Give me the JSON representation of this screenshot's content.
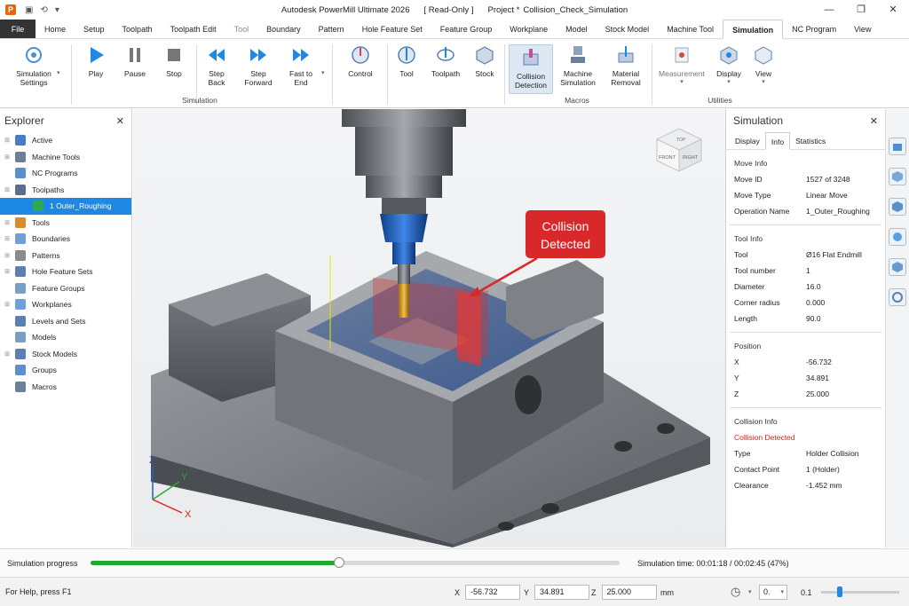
{
  "titlebar": {
    "logo": "P",
    "app_title": "Autodesk PowerMill Ultimate 2026",
    "readonly": "[ Read-Only ]",
    "project": "Project *",
    "file": "Collision_Check_Simulation"
  },
  "menu": {
    "file": "File",
    "tabs": [
      "Home",
      "Setup",
      "Toolpath",
      "Toolpath Edit",
      "Tool",
      "Boundary",
      "Pattern",
      "Hole Feature Set",
      "Feature Group",
      "Workplane",
      "Model",
      "Stock Model",
      "Machine Tool",
      "Simulation",
      "NC Program",
      "View"
    ]
  },
  "ribbon": {
    "simulation_settings": "Simulation Settings",
    "play": "Play",
    "pause": "Pause",
    "stop": "Stop",
    "step_back": "Step Back",
    "step_forward": "Step Forward",
    "fast_to_end": "Fast to End",
    "control": "Control",
    "tool": "Tool",
    "toolpath": "Toolpath",
    "stock": "Stock",
    "collision_detection": "Collision Detection",
    "machine_simulation": "Machine Simulation",
    "material_removal": "Material Removal",
    "measurement": "Measurement",
    "display": "Display",
    "view": "View",
    "group_simulation": "Simulation",
    "group_macros": "Macros",
    "group_utilities": "Utilities"
  },
  "explorer": {
    "title": "Explorer",
    "items": [
      {
        "label": "Active",
        "color": "#4a7bc8"
      },
      {
        "label": "Machine Tools",
        "color": "#6b7f99"
      },
      {
        "label": "NC Programs",
        "color": "#5b8fd0"
      },
      {
        "label": "Toolpaths",
        "color": "#5a6f90"
      },
      {
        "label": "1 Outer_Roughing",
        "color": "#2fa84f"
      },
      {
        "label": "Tools",
        "color": "#d98c2a"
      },
      {
        "label": "Boundaries",
        "color": "#6fa0d8"
      },
      {
        "label": "Patterns",
        "color": "#8a8a8a"
      },
      {
        "label": "Hole Feature Sets",
        "color": "#5a7fb0"
      },
      {
        "label": "Feature Groups",
        "color": "#7a9ec8"
      },
      {
        "label": "Workplanes",
        "color": "#6fa0d8"
      },
      {
        "label": "Levels and Sets",
        "color": "#5a7fb0"
      },
      {
        "label": "Models",
        "color": "#7a9ec8"
      },
      {
        "label": "Stock Models",
        "color": "#5a7fb0"
      },
      {
        "label": "Groups",
        "color": "#5b8fd0"
      },
      {
        "label": "Macros",
        "color": "#6b7f99"
      }
    ]
  },
  "viewport": {
    "callout": [
      "Collision",
      "Detected"
    ],
    "cube_front": "FRONT",
    "cube_right": "RIGHT",
    "cube_top": "TOP",
    "axis_x": "X",
    "axis_y": "Y",
    "axis_z": "Z"
  },
  "simpanel": {
    "title": "Simulation",
    "tabs": [
      "Display",
      "Info",
      "Statistics"
    ],
    "move_info": "Move Info",
    "move_id_k": "Move ID",
    "move_id_v": "1527 of 3248",
    "move_type_k": "Move Type",
    "move_type_v": "Linear Move",
    "op_k": "Operation Name",
    "op_v": "1_Outer_Roughing",
    "tool_info": "Tool Info",
    "tool_k": "Tool",
    "tool_v": "Ø16 Flat Endmill",
    "tooln_k": "Tool number",
    "tooln_v": "1",
    "dia_k": "Diameter",
    "dia_v": "16.0",
    "cr_k": "Corner radius",
    "cr_v": "0.000",
    "len_k": "Length",
    "len_v": "90.0",
    "position": "Position",
    "x_k": "X",
    "x_v": "-56.732",
    "y_k": "Y",
    "y_v": "34.891",
    "z_k": "Z",
    "z_v": "25.000",
    "collision_info": "Collision Info",
    "collision_detected": "Collision Detected",
    "type_k": "Type",
    "type_v": "Holder Collision",
    "cp_k": "Contact Point",
    "cp_v": "1 (Holder)",
    "cl_k": "Clearance",
    "cl_v": "-1.452 mm"
  },
  "progress": {
    "label": "Simulation progress",
    "fraction": 0.47,
    "time": "Simulation time: 00:01:18 / 00:02:45 (47%)"
  },
  "status": {
    "help": "For Help, press F1",
    "x_label": "X",
    "x_value": "-56.732",
    "y_label": "Y",
    "y_value": "34.891",
    "z_label": "Z",
    "z_value": "25.000",
    "unit": "mm",
    "tol": "0.",
    "step": "0.1"
  },
  "colors": {
    "accent": "#1e88e5",
    "collision_red": "#e02020",
    "progress_green": "#22a82c",
    "holder_blue": "#1f5fbf"
  }
}
